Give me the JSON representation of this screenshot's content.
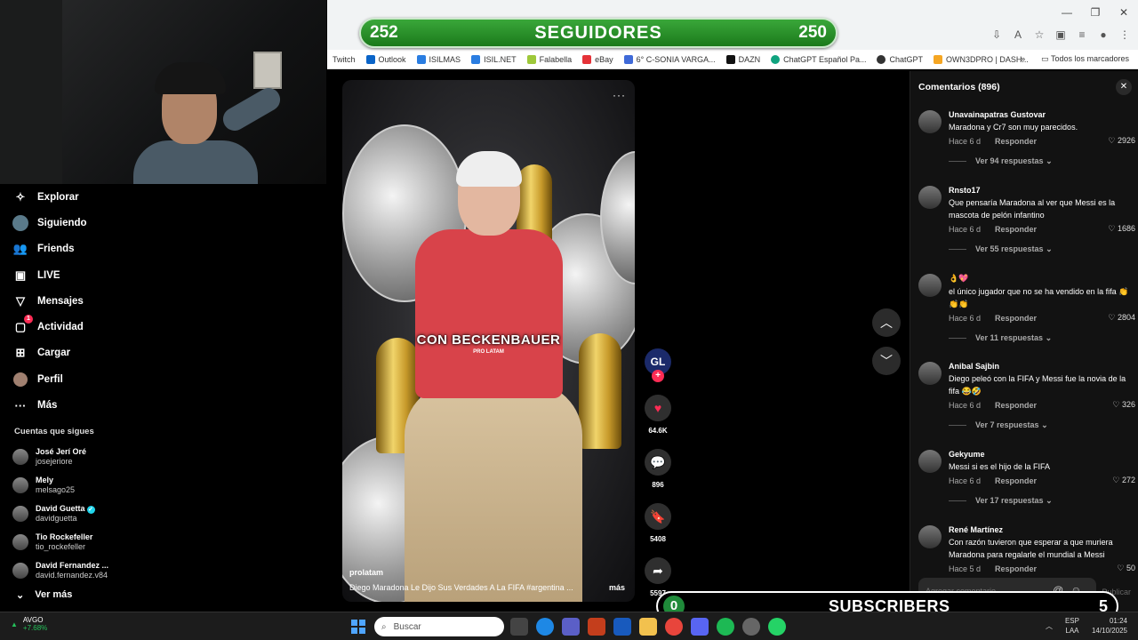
{
  "overlay_top": {
    "left_count": "252",
    "label": "SEGUIDORES",
    "right_count": "250"
  },
  "overlay_bottom": {
    "left_count": "0",
    "label": "SUBSCRIBERS",
    "right_count": "5"
  },
  "bookmarks": [
    "Twitch",
    "Outlook",
    "ISILMAS",
    "ISIL.NET",
    "Falabella",
    "eBay",
    "6° C-SONIA VARGA...",
    "DAZN",
    "ChatGPT Español Pa...",
    "ChatGPT",
    "OWN3DPRO | DASH..."
  ],
  "bookmarks_all": "Todos los marcadores",
  "nav": [
    {
      "label": "Explorar",
      "icon": "compass-icon"
    },
    {
      "label": "Siguiendo",
      "icon": "following-avatar-icon"
    },
    {
      "label": "Friends",
      "icon": "friends-icon"
    },
    {
      "label": "LIVE",
      "icon": "live-icon"
    },
    {
      "label": "Mensajes",
      "icon": "messages-icon"
    },
    {
      "label": "Actividad",
      "icon": "activity-icon",
      "badge": "1"
    },
    {
      "label": "Cargar",
      "icon": "upload-icon"
    },
    {
      "label": "Perfil",
      "icon": "profile-icon"
    },
    {
      "label": "Más",
      "icon": "more-icon"
    }
  ],
  "following_title": "Cuentas que sigues",
  "following": [
    {
      "name": "José Jerí Oré",
      "user": "josejeriore",
      "verified": false
    },
    {
      "name": "Mely",
      "user": "melsago25",
      "verified": false
    },
    {
      "name": "David Guetta",
      "user": "davidguetta",
      "verified": true
    },
    {
      "name": "Tio Rockefeller",
      "user": "tio_rockefeller",
      "verified": false
    },
    {
      "name": "David Fernandez ...",
      "user": "david.fernandez.v84",
      "verified": false
    }
  ],
  "see_more": "Ver más",
  "video": {
    "caption": "CON BECKENBAUER",
    "sub_caption": "PRO LATAM",
    "author": "prolatam",
    "description": "Diego Maradona Le Dijo Sus Verdades A La FIFA  #argentina ...",
    "more": "más",
    "author_badge": "GL"
  },
  "actions": {
    "likes": "64.6K",
    "comments": "896",
    "saves": "5408",
    "shares": "5597"
  },
  "comments_panel": {
    "title": "Comentarios (896)",
    "placeholder": "Agregar comentario...",
    "post": "Publicar",
    "items": [
      {
        "user": "Unavainapatras Gustovar",
        "text": "Maradona y Cr7 son muy parecidos.",
        "time": "Hace 6 d",
        "reply": "Responder",
        "likes": "2926",
        "replies": "Ver 94 respuestas"
      },
      {
        "user": "Rnsto17",
        "text": "Que pensaría Maradona al ver que Messi es la mascota de pelón infantino",
        "time": "Hace 6 d",
        "reply": "Responder",
        "likes": "1686",
        "replies": "Ver 55 respuestas"
      },
      {
        "user": "👌💖",
        "text": "el único jugador que no se ha vendido en la fifa 👏👏👏",
        "time": "Hace 6 d",
        "reply": "Responder",
        "likes": "2804",
        "replies": "Ver 11 respuestas"
      },
      {
        "user": "Anibal Sajbin",
        "text": "Diego peleó con la FIFA y Messi fue la novia de la fifa 😂🤣",
        "time": "Hace 6 d",
        "reply": "Responder",
        "likes": "326",
        "replies": "Ver 7 respuestas"
      },
      {
        "user": "Gekyume",
        "text": "Messi si es el hijo de la FIFA",
        "time": "Hace 6 d",
        "reply": "Responder",
        "likes": "272",
        "replies": "Ver 17 respuestas"
      },
      {
        "user": "René Martínez",
        "text": "Con razón tuvieron que esperar a que muriera Maradona para regalarle el mundial a Messi",
        "time": "Hace 5 d",
        "reply": "Responder",
        "likes": "50",
        "replies": ""
      }
    ]
  },
  "taskbar": {
    "weather_name": "AVGO",
    "weather_change": "+7.68%",
    "search": "Buscar",
    "lang": "ESP",
    "lang2": "LAA",
    "time": "01:24",
    "date": "14/10/2025"
  },
  "colors": {
    "seg_green": "#2a942a",
    "like_red": "#fe2c55",
    "panel_bg": "#121212"
  }
}
